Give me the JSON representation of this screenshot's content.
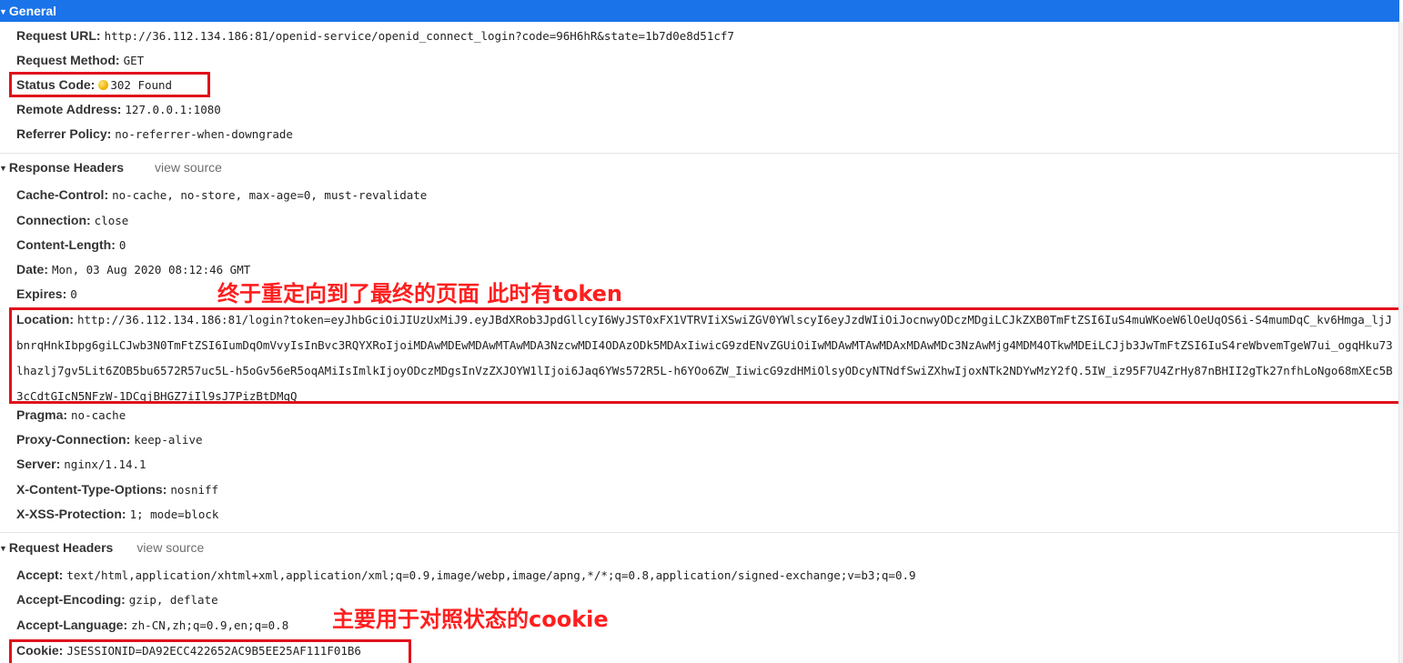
{
  "sections": {
    "general": {
      "title": "General"
    },
    "response": {
      "title": "Response Headers",
      "view_source": "view source"
    },
    "request": {
      "title": "Request Headers",
      "view_source": "view source"
    }
  },
  "general": {
    "request_url": {
      "key": "Request URL:",
      "value": "http://36.112.134.186:81/openid-service/openid_connect_login?code=96H6hR&state=1b7d0e8d51cf7"
    },
    "request_method": {
      "key": "Request Method:",
      "value": "GET"
    },
    "status_code": {
      "key": "Status Code:",
      "value": "302 Found",
      "status_color": "#f0b400"
    },
    "remote_address": {
      "key": "Remote Address:",
      "value": "127.0.0.1:1080"
    },
    "referrer_policy": {
      "key": "Referrer Policy:",
      "value": "no-referrer-when-downgrade"
    }
  },
  "response_headers": {
    "cache_control": {
      "key": "Cache-Control:",
      "value": "no-cache, no-store, max-age=0, must-revalidate"
    },
    "connection": {
      "key": "Connection:",
      "value": "close"
    },
    "content_length": {
      "key": "Content-Length:",
      "value": "0"
    },
    "date": {
      "key": "Date:",
      "value": "Mon, 03 Aug 2020 08:12:46 GMT"
    },
    "expires": {
      "key": "Expires:",
      "value": "0"
    },
    "location": {
      "key": "Location:",
      "value": "http://36.112.134.186:81/login?token=eyJhbGciOiJIUzUxMiJ9.eyJBdXRob3JpdGllcyI6WyJST0xFX1VTRVIiXSwiZGV0YWlscyI6eyJzdWIiOiJocnwyODczMDgiLCJkZXB0TmFtZSI6IuS4muWKoeW6lOeUqOS6i-S4mumDqC_kv6Hmga_ljJbnrqHnkIbpg6giLCJwb3N0TmFtZSI6IumDqOmVvyIsInBvc3RQYXRoIjoiMDAwMDEwMDAwMTAwMDA3NzcwMDI4ODAzODk5MDAxIiwicG9zdENvZGUiOiIwMDAwMTAwMDAxMDAwMDc3NzAwMjg4MDM4OTkwMDEiLCJjb3JwTmFtZSI6IuS4reWbvemTgeW7ui_ogqHku73lhazlj7gv5Lit6ZOB5bu6572R57uc5L-h5oGv56eR5oqAMiIsImlkIjoyODczMDgsInVzZXJOYW1lIjoi6Jaq6YWs572R5L-h6YOo6ZW_IiwicG9zdHMiOlsyODcyNTNdfSwiZXhwIjoxNTk2NDYwMzY2fQ.5IW_iz95F7U4ZrHy87nBHII2gTk27nfhLoNgo68mXEc5B3cCdtGIcN5NFzW-1DCgjBHGZ7iIl9sJ7PizBtDMqQ"
    },
    "pragma": {
      "key": "Pragma:",
      "value": "no-cache"
    },
    "proxy_connection": {
      "key": "Proxy-Connection:",
      "value": "keep-alive"
    },
    "server": {
      "key": "Server:",
      "value": "nginx/1.14.1"
    },
    "x_content_type_options": {
      "key": "X-Content-Type-Options:",
      "value": "nosniff"
    },
    "x_xss_protection": {
      "key": "X-XSS-Protection:",
      "value": "1; mode=block"
    }
  },
  "request_headers": {
    "accept": {
      "key": "Accept:",
      "value": "text/html,application/xhtml+xml,application/xml;q=0.9,image/webp,image/apng,*/*;q=0.8,application/signed-exchange;v=b3;q=0.9"
    },
    "accept_encoding": {
      "key": "Accept-Encoding:",
      "value": "gzip, deflate"
    },
    "accept_language": {
      "key": "Accept-Language:",
      "value": "zh-CN,zh;q=0.9,en;q=0.8"
    },
    "cookie": {
      "key": "Cookie:",
      "value": "JSESSIONID=DA92ECC422652AC9B5EE25AF111F01B6"
    }
  },
  "annotations": {
    "redirect_note": "终于重定向到了最终的页面 此时有token",
    "cookie_note": "主要用于对照状态的cookie",
    "color": "#ff1e1e"
  }
}
